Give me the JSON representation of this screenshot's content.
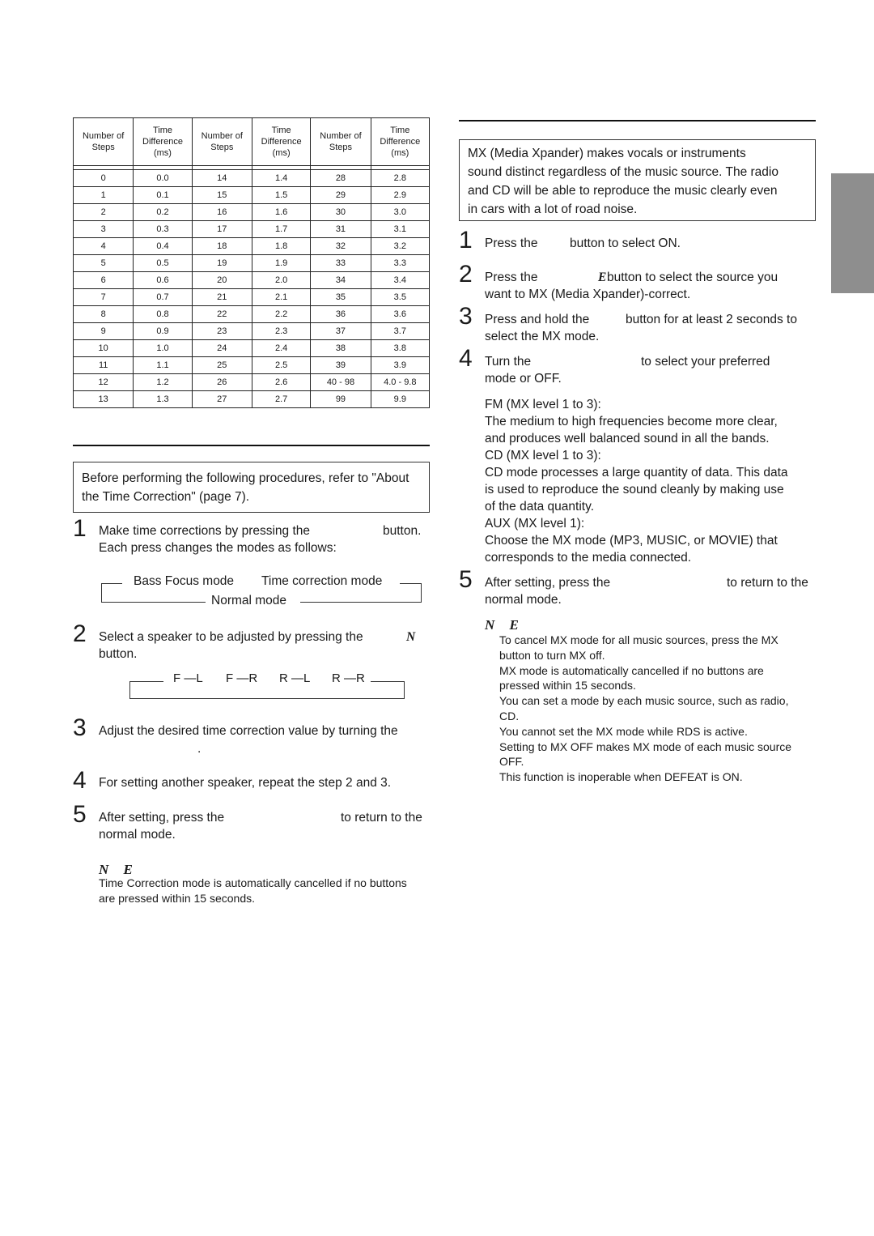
{
  "time_table": {
    "headers": [
      "Number of Steps",
      "Time Difference (ms)",
      "Number of Steps",
      "Time Difference (ms)",
      "Number of Steps",
      "Time Difference (ms)"
    ],
    "header_lines": [
      [
        "",
        "Number of",
        "Steps"
      ],
      [
        "Time",
        "Difference",
        "(ms)"
      ],
      [
        "",
        "Number of",
        "Steps"
      ],
      [
        "Time",
        "Difference",
        "(ms)"
      ],
      [
        "",
        "Number of",
        "Steps"
      ],
      [
        "Time",
        "Difference",
        "(ms)"
      ]
    ],
    "rows": [
      [
        "0",
        "0.0",
        "14",
        "1.4",
        "28",
        "2.8"
      ],
      [
        "1",
        "0.1",
        "15",
        "1.5",
        "29",
        "2.9"
      ],
      [
        "2",
        "0.2",
        "16",
        "1.6",
        "30",
        "3.0"
      ],
      [
        "3",
        "0.3",
        "17",
        "1.7",
        "31",
        "3.1"
      ],
      [
        "4",
        "0.4",
        "18",
        "1.8",
        "32",
        "3.2"
      ],
      [
        "5",
        "0.5",
        "19",
        "1.9",
        "33",
        "3.3"
      ],
      [
        "6",
        "0.6",
        "20",
        "2.0",
        "34",
        "3.4"
      ],
      [
        "7",
        "0.7",
        "21",
        "2.1",
        "35",
        "3.5"
      ],
      [
        "8",
        "0.8",
        "22",
        "2.2",
        "36",
        "3.6"
      ],
      [
        "9",
        "0.9",
        "23",
        "2.3",
        "37",
        "3.7"
      ],
      [
        "10",
        "1.0",
        "24",
        "2.4",
        "38",
        "3.8"
      ],
      [
        "11",
        "1.1",
        "25",
        "2.5",
        "39",
        "3.9"
      ],
      [
        "12",
        "1.2",
        "26",
        "2.6",
        "40 - 98",
        "4.0 - 9.8"
      ],
      [
        "13",
        "1.3",
        "27",
        "2.7",
        "99",
        "9.9"
      ]
    ]
  },
  "left": {
    "intro_box": "Before performing the following procedures, refer to \"About the Time Correction\" (page 7).",
    "steps": [
      {
        "num": "1",
        "line1a": "Make time corrections by pressing the",
        "line1b": "button.",
        "line2": "Each press changes the modes as follows:"
      },
      {
        "num": "2",
        "line1a": "Select a speaker to be adjusted by pressing the",
        "line1b": "N",
        "line2": "button."
      },
      {
        "num": "3",
        "line1": "Adjust the desired time correction value by turning the",
        "line2": "."
      },
      {
        "num": "4",
        "line1": "For setting another speaker, repeat the step 2 and 3."
      },
      {
        "num": "5",
        "line1a": "After setting, press the",
        "line1b": "to return to the",
        "line2": "normal mode."
      }
    ],
    "mode_flow": {
      "a": "Bass Focus mode",
      "b": "Time correction mode",
      "c": "Normal mode"
    },
    "speaker_flow": [
      "F —L",
      "F —R",
      "R —L",
      "R —R"
    ],
    "note_head": "N E",
    "note_text": [
      "Time Correction mode is automatically cancelled if no buttons",
      "are pressed within 15 seconds."
    ]
  },
  "right": {
    "intro_box": [
      "MX (Media Xpander) makes vocals or instruments",
      "sound distinct regardless of the music source. The radio",
      "and CD will be able to reproduce the music clearly even",
      "in cars with a lot of road noise."
    ],
    "steps": [
      {
        "num": "1",
        "a": "Press the",
        "b": "button to select ON."
      },
      {
        "num": "2",
        "a": "Press the",
        "e": "E",
        "b": "button to select the source you",
        "line2": "want to MX (Media Xpander)-correct."
      },
      {
        "num": "3",
        "a": "Press and hold the",
        "b": "button for at least 2 seconds to",
        "line2": "select the MX mode."
      },
      {
        "num": "4",
        "a": "Turn the",
        "b": "to select your preferred",
        "line2": "mode or OFF."
      },
      {
        "num": "5",
        "a": "After setting, press the",
        "b": "to return to the",
        "line2": "normal mode."
      }
    ],
    "modes": [
      "FM (MX level 1 to 3):",
      "The medium to high frequencies become more clear,",
      "and produces well balanced sound in all the bands.",
      "CD (MX level 1 to 3):",
      "CD mode processes a large quantity of data. This data",
      "is used to reproduce the sound cleanly by making use",
      "of the data quantity.",
      "AUX (MX level 1):",
      "Choose the MX mode (MP3, MUSIC, or MOVIE) that",
      "corresponds to the media connected."
    ],
    "note_head": "N E",
    "notes": [
      "To cancel MX mode for all music sources, press the MX",
      "button to turn MX off.",
      "MX mode is automatically cancelled if no buttons are",
      "pressed within 15 seconds.",
      "You can set a mode by each music source, such as radio,",
      "CD.",
      "You cannot set the MX mode while RDS is active.",
      "Setting to MX OFF makes MX mode of each music source",
      "OFF.",
      "This function is inoperable when DEFEAT is ON."
    ]
  }
}
